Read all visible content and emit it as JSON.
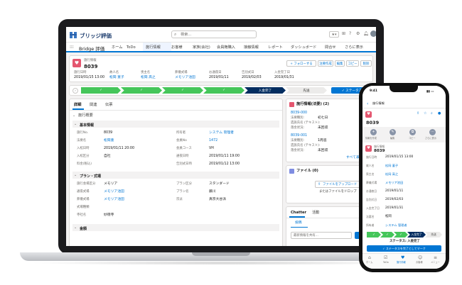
{
  "desktop": {
    "logo_text": "ブリッジ評価",
    "search_placeholder": "検索...",
    "app_name": "Bridge 評価",
    "nav_items": [
      "ホーム",
      "ToDo",
      "施行情報",
      "お客様",
      "家族(会社)",
      "会員権購入",
      "接触情報",
      "レポート",
      "ダッシュボード",
      "問合せ",
      "さらに表示"
    ],
    "record": {
      "type_label": "施行情報",
      "number": "8039",
      "buttons": [
        "+ フォローする",
        "注要作成",
        "編集",
        "コピー",
        "削除"
      ],
      "summary_labels": [
        "施行日時",
        "故人名",
        "喪主名",
        "葬儀式場",
        "お通夜日",
        "告別式日",
        "入金完了日"
      ],
      "summary_values": [
        "2019/01/15 13:00",
        "松岡 菫子",
        "松岡 高之",
        "メモリア池田",
        "2019/01/11",
        "2019/02/03",
        "2019/01/31"
      ],
      "path_stages": [
        "✓",
        "✓",
        "✓",
        "✓",
        "入金完了",
        "先送"
      ],
      "path_button": "✓ ステータス"
    },
    "tabs": [
      "詳細",
      "関連",
      "伝票"
    ],
    "section_overview": "施行概要",
    "section_basic": "基本情報",
    "basic_fields": {
      "left_labels": [
        "施行No.",
        "法要名",
        "入棺日時",
        "入棺区分",
        "料金(税込)"
      ],
      "left_values": [
        "8039",
        "松岡菫",
        "2019/01/11 20:00",
        "自社",
        ""
      ],
      "right_labels": [
        "所有者",
        "会員No",
        "会員コース",
        "通夜日時",
        "告別式日時"
      ],
      "right_values": [
        "システム 管理者",
        "1472",
        "VH",
        "2019/01/11 19:00",
        "2019/01/12 13:00"
      ]
    },
    "section_plan": "プラン・式場",
    "plan_fields": {
      "left_labels": [
        "施行会場区分",
        "通夜式場",
        "葬儀式場",
        "式場種類",
        "寺社名"
      ],
      "left_values": [
        "メモリア",
        "メモリア池田",
        "メモリア池田",
        "",
        "妙徳寺"
      ],
      "right_labels": [
        "プラン区分",
        "プラン名",
        "宗派"
      ],
      "right_values": [
        "スタンダード",
        "藤川",
        "真宗大谷派"
      ]
    },
    "section_money": "金額",
    "related": {
      "title": "施行情報(法要) (2)",
      "records": [
        {
          "id": "8039-000",
          "rows": [
            [
              "法要種別:",
              "初七日"
            ],
            [
              "遺族氏名 (テキスト):",
              ""
            ],
            [
              "落金状況:",
              "未回収"
            ]
          ]
        },
        {
          "id": "8039-001",
          "rows": [
            [
              "法要種別:",
              "1周忌"
            ],
            [
              "遺族氏名 (テキスト):",
              ""
            ],
            [
              "落金状況:",
              "未回収"
            ]
          ]
        }
      ],
      "view_all": "すべて表示"
    },
    "files": {
      "title": "ファイル (0)",
      "upload": "ファイルをアップロード",
      "drop": "またはファイルをドロップ"
    },
    "chatter": {
      "tabs": [
        "Chatter",
        "活動"
      ],
      "post_tab": "投稿",
      "share": "共有",
      "placeholder": "最新情報を共有..."
    }
  },
  "mobile": {
    "time": "9:41",
    "back": "施行情報",
    "number": "8039",
    "actions": [
      "情報を作成",
      "編集",
      "コピー",
      "さらに表示"
    ],
    "record_type": "施行情報",
    "record_number": "8039",
    "field_labels": [
      "施行日時",
      "故人名",
      "喪主名",
      "葬儀式場",
      "お通夜日",
      "告別式日",
      "入金完了日",
      "法要名",
      "所有者"
    ],
    "field_values": [
      "2019/01/15 13:00",
      "松岡 菫子",
      "松岡 高之",
      "メモリア池田",
      "2019/01/11",
      "2019/02/03",
      "2019/01/31",
      "松岡",
      "システム 管理者"
    ],
    "path_current": "入金完了",
    "path_next": "先送",
    "status_text": "ステータス: 入金完了",
    "complete_button": "✓ ステータスを完了としてマーク",
    "bottom_nav": [
      "ホーム",
      "ToDo",
      "施行情報",
      "お客様",
      "メニュー"
    ]
  },
  "colors": {
    "brand": "#0176d3",
    "path_done": "#45c65a",
    "path_current": "#032d60",
    "record_icon": "#e4566f"
  }
}
